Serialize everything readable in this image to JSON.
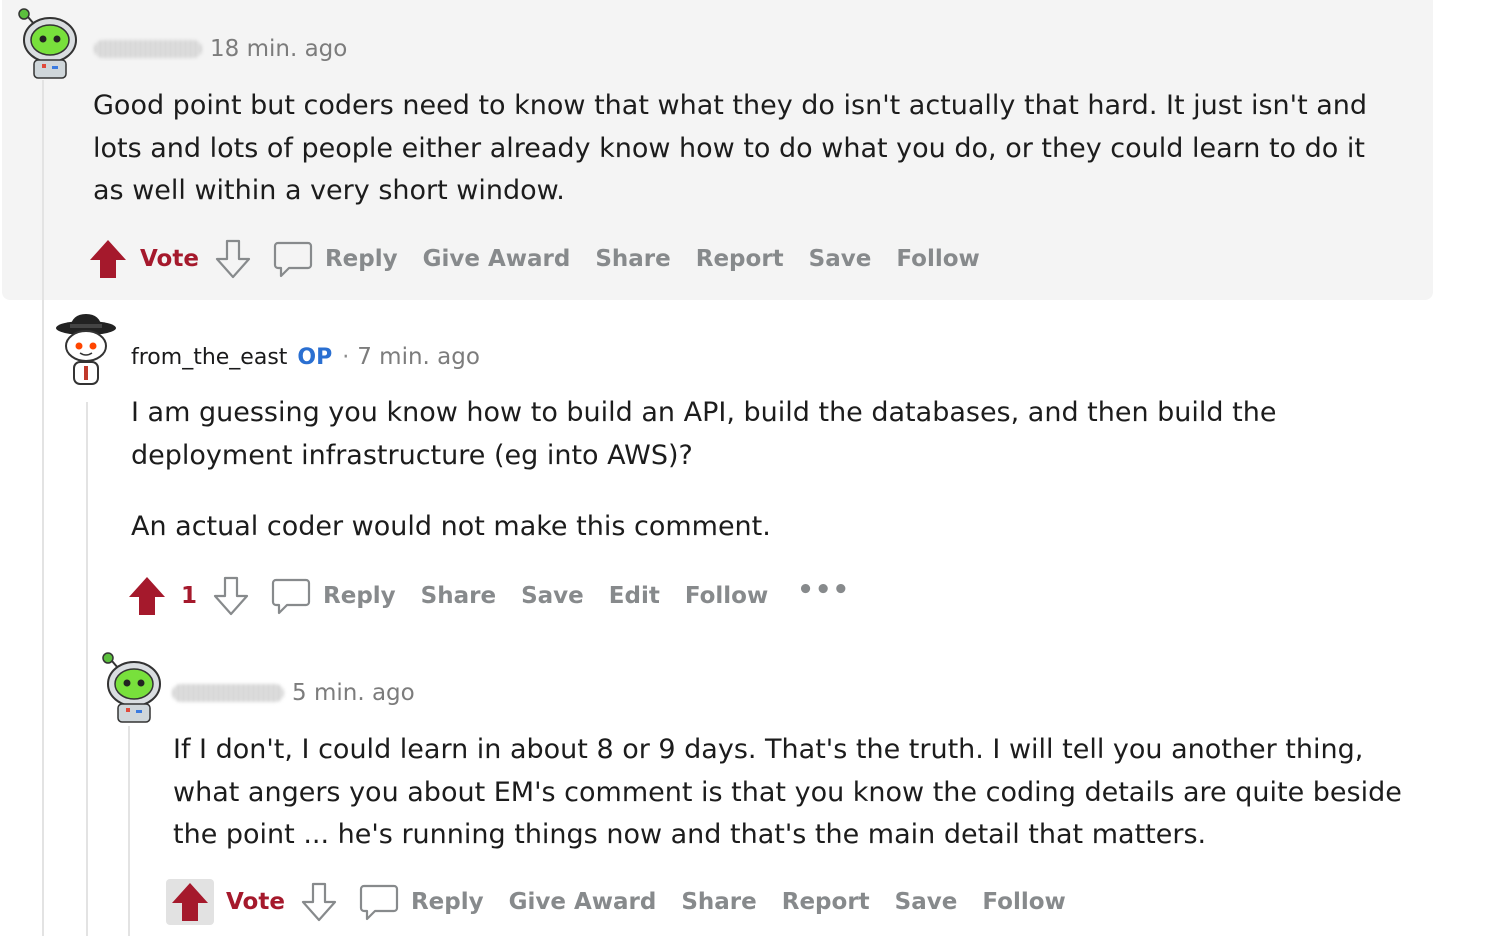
{
  "comments": [
    {
      "timestamp": "18 min. ago",
      "body": [
        "Good point but coders need to know that what they do isn't actually that hard. It just isn't and lots and lots of people either already know how to do what you do, or they could learn to do it as well within a very short window."
      ],
      "actions": {
        "vote_label": "Vote",
        "reply": "Reply",
        "give_award": "Give Award",
        "share": "Share",
        "report": "Report",
        "save": "Save",
        "follow": "Follow"
      }
    },
    {
      "author": "from_the_east",
      "op_badge": "OP",
      "separator": "·",
      "timestamp": "7 min. ago",
      "body": [
        "I am guessing you know how to build an API, build the databases, and then build the deployment infrastructure (eg into AWS)?",
        "An actual coder would not make this comment."
      ],
      "actions": {
        "score": "1",
        "reply": "Reply",
        "share": "Share",
        "save": "Save",
        "edit": "Edit",
        "follow": "Follow",
        "more": "•••"
      }
    },
    {
      "timestamp": "5 min. ago",
      "body": [
        "If I don't, I could learn in about 8 or 9 days. That's the truth. I will tell you another thing, what angers you about EM's comment is that you know the coding details are quite beside the point ... he's running things now and that's the main detail that matters."
      ],
      "actions": {
        "vote_label": "Vote",
        "reply": "Reply",
        "give_award": "Give Award",
        "share": "Share",
        "report": "Report",
        "save": "Save",
        "follow": "Follow"
      }
    }
  ],
  "icons": {
    "upvote": "upvote-arrow-icon",
    "downvote": "downvote-arrow-icon",
    "reply": "speech-bubble-icon",
    "avatar_robot": "robot-snoo-avatar",
    "avatar_hat": "hat-snoo-avatar"
  },
  "colors": {
    "vote_active": "#a5192c",
    "action_gray": "#878a8c",
    "op_blue": "#2a6fd1",
    "highlight_bg": "#f4f4f4"
  }
}
